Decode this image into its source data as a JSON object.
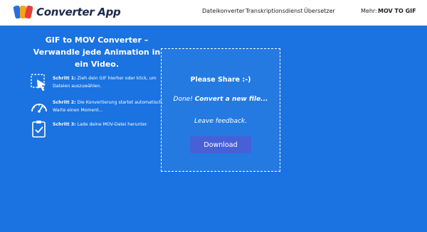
{
  "header": {
    "logo_text": "Converter App",
    "nav": [
      "Dateikonverter",
      "Transkriptionsdienst",
      "Übersetzer"
    ],
    "more_label": "Mehr:",
    "more_value": "MOV TO GIF"
  },
  "main": {
    "title": "GIF to MOV Converter – Verwandle jede Animation in ein Video.",
    "steps": [
      {
        "label": "Schritt 1:",
        "text": "Zieh dein GIF hierher oder klick, um Dateien auszuwählen.",
        "icon": "cursor-select-icon"
      },
      {
        "label": "Schritt 2:",
        "text": "Die Konvertierung startet automatisch. Warte einen Moment...",
        "icon": "speedometer-icon"
      },
      {
        "label": "Schritt 3:",
        "text": "Lade deine MOV-Datei herunter.",
        "icon": "clipboard-check-icon"
      }
    ]
  },
  "dropzone": {
    "title": "Please Share :-)",
    "done_prefix": "Done!",
    "done_link": "Convert a new file...",
    "feedback": "Leave feedback.",
    "download_label": "Download"
  },
  "colors": {
    "background": "#1a73e0",
    "header": "#ffffff",
    "button": "#4760d8"
  }
}
